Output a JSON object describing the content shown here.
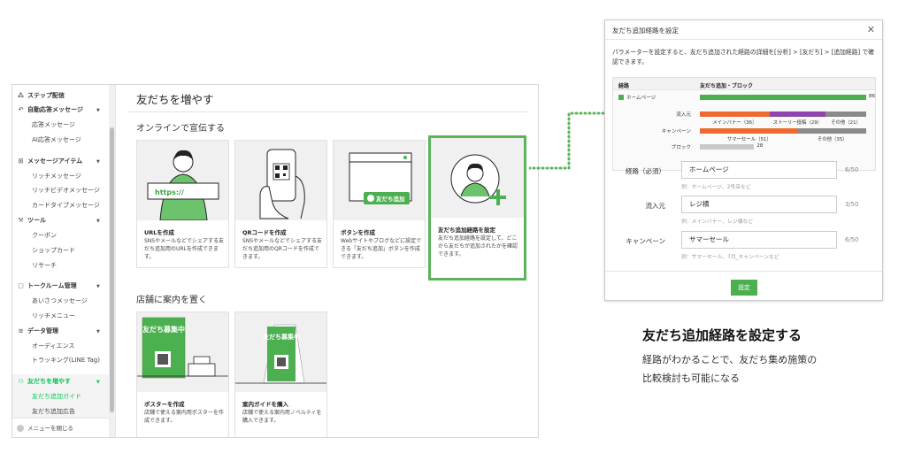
{
  "sidebar": {
    "items": [
      {
        "label": "ステップ配信",
        "icon": "org-chart-icon",
        "type": "section"
      },
      {
        "label": "自動応答メッセージ",
        "icon": "reply-icon",
        "type": "section",
        "expanded": true
      },
      {
        "label": "応答メッセージ",
        "type": "sub"
      },
      {
        "label": "AI応答メッセージ",
        "type": "sub"
      },
      {
        "label": "メッセージアイテム",
        "icon": "plus-square-icon",
        "type": "section",
        "expanded": true
      },
      {
        "label": "リッチメッセージ",
        "type": "sub"
      },
      {
        "label": "リッチビデオメッセージ",
        "type": "sub"
      },
      {
        "label": "カードタイプメッセージ",
        "type": "sub"
      },
      {
        "label": "ツール",
        "icon": "tools-icon",
        "type": "section",
        "expanded": true
      },
      {
        "label": "クーポン",
        "type": "sub"
      },
      {
        "label": "ショップカード",
        "type": "sub"
      },
      {
        "label": "リサーチ",
        "type": "sub"
      },
      {
        "label": "トークルーム管理",
        "icon": "chat-icon",
        "type": "section",
        "expanded": true
      },
      {
        "label": "あいさつメッセージ",
        "type": "sub"
      },
      {
        "label": "リッチメニュー",
        "type": "sub"
      },
      {
        "label": "データ管理",
        "icon": "database-icon",
        "type": "section",
        "expanded": true
      },
      {
        "label": "オーディエンス",
        "type": "sub"
      },
      {
        "label": "トラッキング(LINE Tag)",
        "type": "sub"
      },
      {
        "label": "友だちを増やす",
        "icon": "person-add-icon",
        "type": "section",
        "expanded": true,
        "active": true
      },
      {
        "label": "友だち追加ガイド",
        "type": "sub",
        "active": true
      },
      {
        "label": "友だち追加広告",
        "type": "sub"
      }
    ],
    "footer": "メニューを閉じる"
  },
  "main": {
    "title": "友だちを増やす",
    "section_online": "オンラインで宣伝する",
    "section_store": "店舗に案内を置く",
    "cards_online": [
      {
        "title": "URLを作成",
        "desc": "SNSやメールなどでシェアする友だち追加用のURLを作成できます。",
        "thumb_text": "https://"
      },
      {
        "title": "QRコードを作成",
        "desc": "SNSやメールなどでシェアする友だち追加用のQRコードを作成できます。"
      },
      {
        "title": "ボタンを作成",
        "desc": "Webサイトやブログなどに設定できる「友だち追加」ボタンを作成できます。",
        "thumb_text": "友だち追加"
      },
      {
        "title": "友だち追加経路を設定",
        "desc": "友だち追加経路を設定して、どこから友だちが追加されたかを確認できます。"
      }
    ],
    "cards_store": [
      {
        "title": "ポスターを作成",
        "desc": "店舗で使える案内用ポスターを作成できます。",
        "thumb_text": "友だち募集中"
      },
      {
        "title": "案内ガイドを購入",
        "desc": "店舗で使える案内用ノベルティを購入できます。",
        "thumb_text": "友だち募集中"
      }
    ]
  },
  "dialog": {
    "title": "友だち追加経路を設定",
    "description": "パラメーターを設定すると、友だち追加された経路の詳細を[分析] > [友だち] > [追加経路] で確認できます。",
    "chart_col1": "経路",
    "chart_col2": "友だち追加・ブロック",
    "fields": [
      {
        "label": "経路（必須）",
        "value": "ホームページ",
        "count": "6/50",
        "help": "例：ホームページ、2号店など"
      },
      {
        "label": "流入元",
        "value": "レジ横",
        "count": "3/50",
        "help": "例：メインバナー、レジ横など"
      },
      {
        "label": "キャンペーン",
        "value": "サマーセール",
        "count": "6/50",
        "help": "例：サマーセール、7月_キャンペーンなど"
      }
    ],
    "submit": "設定"
  },
  "chart_data": {
    "type": "bar",
    "title": "友だち追加・ブロック",
    "rows": [
      {
        "label": "ホームページ",
        "value": 86,
        "color": "#4caf50"
      },
      {
        "label": "流入元",
        "segments": [
          {
            "name": "メインバナー",
            "value": 36,
            "color": "#ee6a2e"
          },
          {
            "name": "ストーリー投稿",
            "value": 29,
            "color": "#8e44ad"
          },
          {
            "name": "その他",
            "value": 21,
            "color": "#8a8a8a"
          }
        ]
      },
      {
        "label": "キャンペーン",
        "segments": [
          {
            "name": "サマーセール",
            "value": 51,
            "color": "#ee6a2e"
          },
          {
            "name": "その他",
            "value": 35,
            "color": "#8a8a8a"
          }
        ]
      },
      {
        "label": "ブロック",
        "value": 28,
        "color": "#c8c8c8"
      }
    ]
  },
  "caption": {
    "title": "友だち追加経路を設定する",
    "line1": "経路がわかることで、友だち集め施策の",
    "line2": "比較検討も可能になる"
  },
  "colors": {
    "brand_green": "#06c755",
    "highlight": "#5ab55a"
  }
}
